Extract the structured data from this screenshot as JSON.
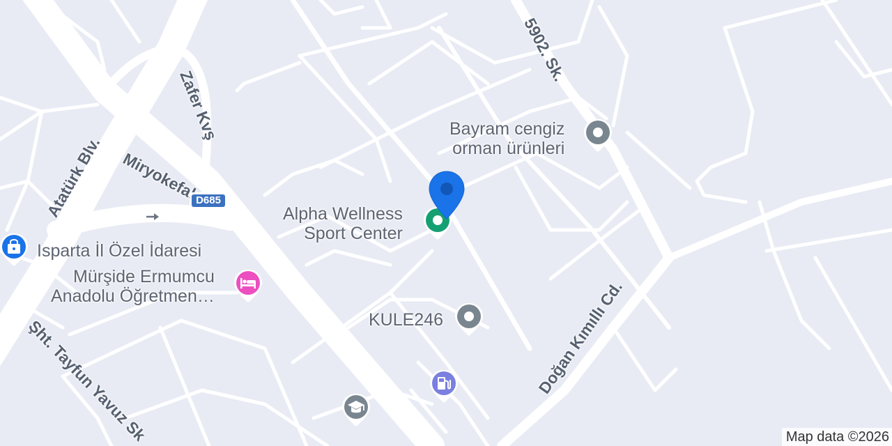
{
  "streets": {
    "ataturk": "Atatürk Blv.",
    "miryokefalon": "Miryokefalon",
    "zafer": "Zafer Kvş",
    "s5902": "5902. Sk.",
    "dogan": "Doğan Kımıllı Cd.",
    "tayfun": "Şht. Tayfun Yavuz Sk"
  },
  "route_shield": "D685",
  "pois": [
    {
      "name": "Bayram cengiz orman ürünleri",
      "lines": [
        "Bayram cengiz",
        "orman ürünleri"
      ],
      "icon": "dot-icon",
      "color": "#79868f"
    },
    {
      "name": "Alpha Wellness Sport Center",
      "lines": [
        "Alpha Wellness",
        "Sport Center"
      ],
      "icon": "dot-icon",
      "color": "#15a072"
    },
    {
      "name": "Isparta İl Özel İdaresi",
      "lines": [
        "Isparta İl Özel İdaresi"
      ],
      "icon": "shopping-bag-icon",
      "color": "#1a73e8"
    },
    {
      "name": "Mürşide Ermumcu Anadolu Öğretmen…",
      "lines": [
        "Mürşide Ermumcu",
        "Anadolu Öğretmen…"
      ],
      "icon": "bed-icon",
      "color": "#ec4fc0"
    },
    {
      "name": "KULE246",
      "lines": [
        "KULE246"
      ],
      "icon": "dot-icon",
      "color": "#79868f"
    },
    {
      "name": "",
      "lines": [],
      "icon": "gas-station-icon",
      "color": "#7a7fe0"
    },
    {
      "name": "",
      "lines": [],
      "icon": "graduation-cap-icon",
      "color": "#79868f"
    }
  ],
  "selected_pin_color": "#1a73e8",
  "attribution": "Map data ©2026"
}
